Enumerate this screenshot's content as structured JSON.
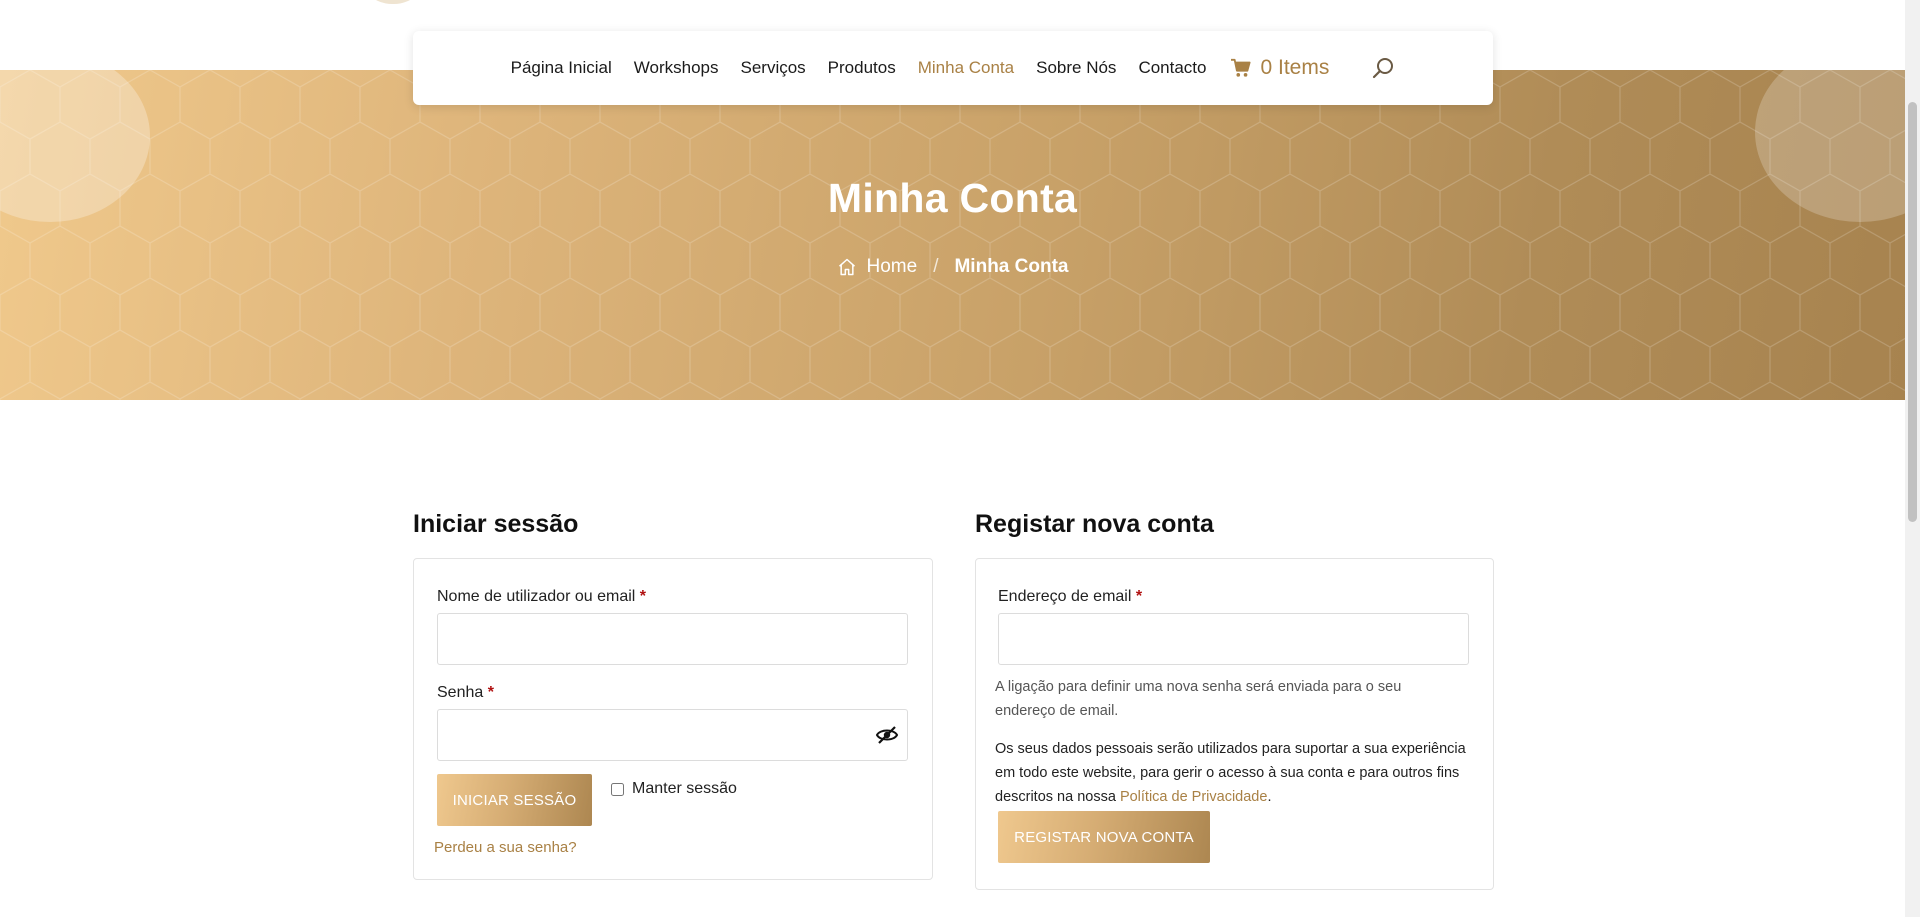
{
  "nav": {
    "items": [
      {
        "label": "Página Inicial",
        "active": false
      },
      {
        "label": "Workshops",
        "active": false
      },
      {
        "label": "Serviços",
        "active": false
      },
      {
        "label": "Produtos",
        "active": false
      },
      {
        "label": "Minha Conta",
        "active": true
      },
      {
        "label": "Sobre Nós",
        "active": false
      },
      {
        "label": "Contacto",
        "active": false
      }
    ],
    "cart_label": "0 Items",
    "cart_icon": "cart-icon",
    "search_icon": "search-icon"
  },
  "hero": {
    "title": "Minha Conta",
    "breadcrumb": {
      "home": "Home",
      "separator": "/",
      "current": "Minha Conta"
    }
  },
  "login": {
    "title": "Iniciar sessão",
    "username_label": "Nome de utilizador ou email",
    "password_label": "Senha",
    "required_mark": "*",
    "username_value": "",
    "password_value": "",
    "submit_label": "INICIAR SESSÃO",
    "remember_label": "Manter sessão",
    "remember_checked": false,
    "lost_password": "Perdeu a sua senha?"
  },
  "register": {
    "title": "Registar nova conta",
    "email_label": "Endereço de email",
    "required_mark": "*",
    "email_value": "",
    "note": "A ligação para definir uma nova senha será enviada para o seu endereço de email.",
    "privacy_text": "Os seus dados pessoais serão utilizados para suportar a sua experiência em todo este website, para gerir o acesso à sua conta e para outros fins descritos na nossa",
    "privacy_link": "Política de Privacidade",
    "privacy_end": ".",
    "submit_label": "REGISTAR NOVA CONTA"
  },
  "colors": {
    "accent": "#a98145",
    "gradient_start": "#f0c98c",
    "gradient_end": "#a7834f",
    "required": "#b01010"
  }
}
